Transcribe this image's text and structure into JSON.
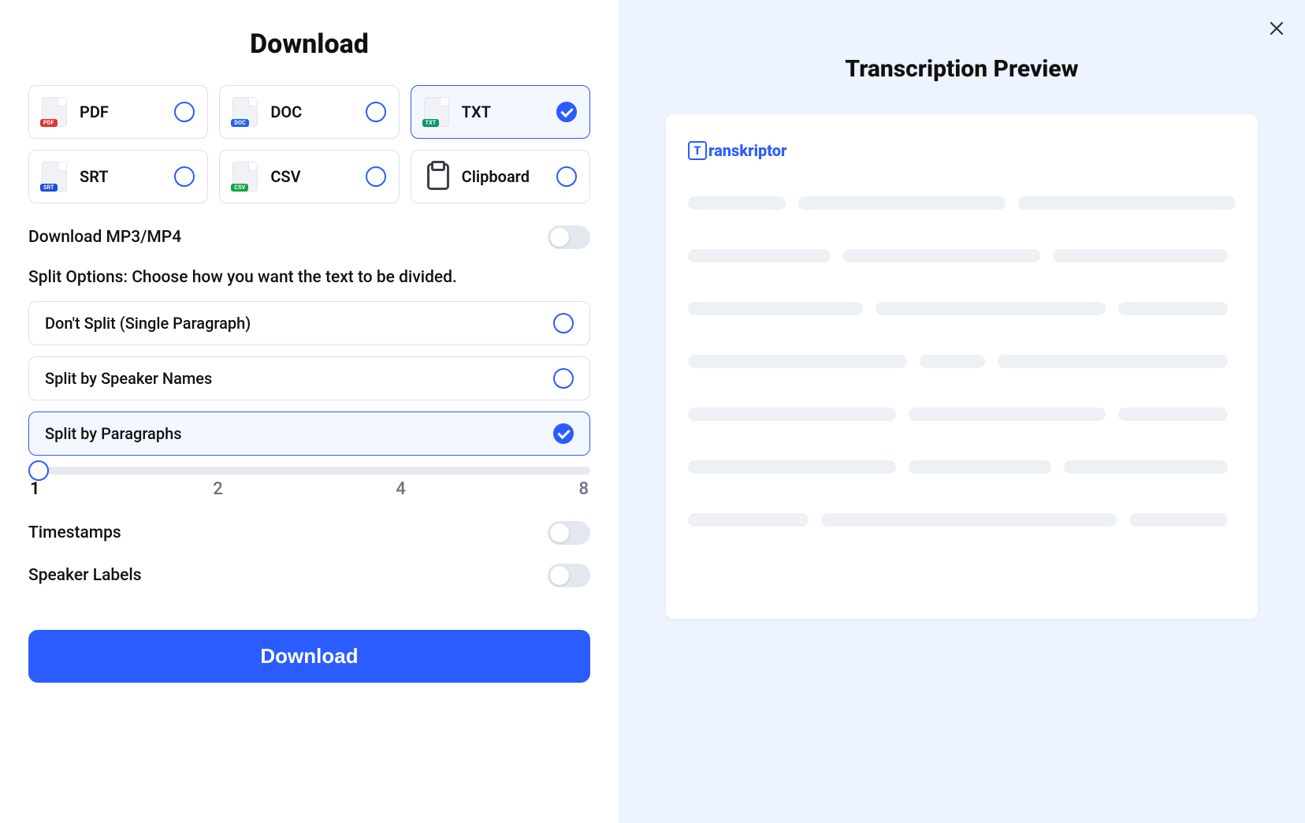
{
  "left": {
    "title": "Download",
    "formats": [
      {
        "label": "PDF",
        "badge": "PDF",
        "badgeClass": "badge-pdf",
        "selected": false
      },
      {
        "label": "DOC",
        "badge": "DOC",
        "badgeClass": "badge-doc",
        "selected": false
      },
      {
        "label": "TXT",
        "badge": "TXT",
        "badgeClass": "badge-txt",
        "selected": true
      },
      {
        "label": "SRT",
        "badge": "SRT",
        "badgeClass": "badge-srt",
        "selected": false
      },
      {
        "label": "CSV",
        "badge": "CSV",
        "badgeClass": "badge-csv",
        "selected": false
      },
      {
        "label": "Clipboard",
        "clipboard": true,
        "selected": false
      }
    ],
    "download_media_label": "Download MP3/MP4",
    "download_media_on": false,
    "split_section_label": "Split Options: Choose how you want the text to be divided.",
    "split_options": [
      {
        "label": "Don't Split (Single Paragraph)",
        "selected": false
      },
      {
        "label": "Split by Speaker Names",
        "selected": false
      },
      {
        "label": "Split by Paragraphs",
        "selected": true
      }
    ],
    "slider": {
      "value": 1,
      "ticks": [
        "1",
        "2",
        "4",
        "8"
      ]
    },
    "timestamps_label": "Timestamps",
    "timestamps_on": false,
    "speaker_labels_label": "Speaker Labels",
    "speaker_labels_on": false,
    "download_button": "Download"
  },
  "right": {
    "title": "Transcription Preview",
    "brand": "ranskriptor",
    "brand_initial": "T"
  }
}
